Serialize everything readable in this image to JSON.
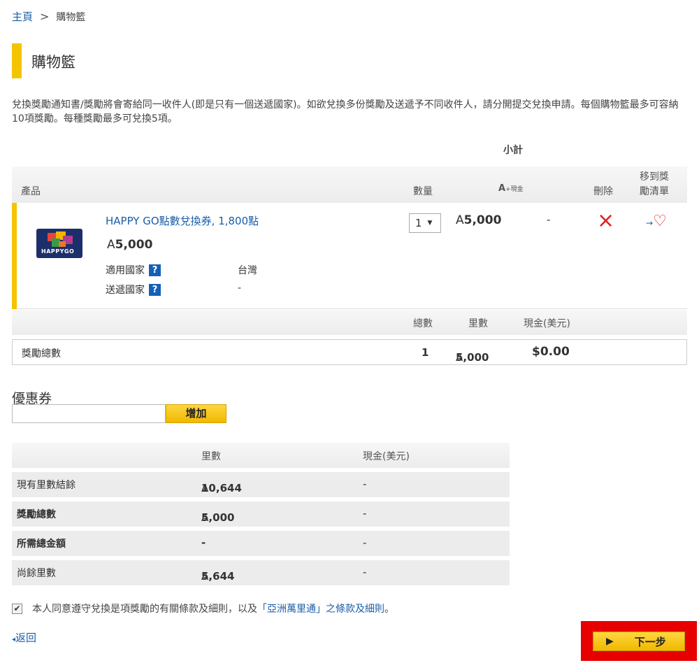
{
  "breadcrumb": {
    "home": "主頁",
    "separator": ">",
    "current": "購物籃"
  },
  "page_title": "購物籃",
  "intro_text": "兌換獎勵通知書/獎勵將會寄給同一收件人(即是只有一個送遞國家)。如欲兌換多份獎勵及送遞予不同收件人，請分開提交兌換申請。每個購物籃最多可容納10項獎勵。每種獎勵最多可兌換5項。",
  "cart": {
    "subtotal_label": "小計",
    "headers": {
      "product": "產品",
      "quantity": "數量",
      "miles_cash": "+現金",
      "delete": "刪除",
      "wishlist_line1": "移到獎",
      "wishlist_line2": "勵清單"
    },
    "item": {
      "name": "HAPPY GO點數兌換券, 1,800點",
      "price": "5,000",
      "country_label": "適用國家",
      "country_value": "台灣",
      "delivery_label": "送遞國家",
      "delivery_value": "-",
      "quantity": "1",
      "subtotal_miles": "5,000",
      "subtotal_cash": "-",
      "logo_text": "HAPPYGO"
    },
    "totals_headers": {
      "count": "總數",
      "miles": "里數",
      "cash": "現金(美元)"
    },
    "totals_row": {
      "label": "獎勵總數",
      "count": "1",
      "miles": "5,000",
      "cash": "$0.00"
    }
  },
  "coupon": {
    "title": "優惠券",
    "input_value": "",
    "add_button": "增加"
  },
  "summary": {
    "headers": {
      "miles": "里數",
      "cash": "現金(美元)"
    },
    "rows": [
      {
        "label": "現有里數結餘",
        "miles": "10,644",
        "cash": "-",
        "bold": false
      },
      {
        "label": "獎勵總數",
        "miles": "5,000",
        "cash": "-",
        "bold": true
      },
      {
        "label": "所需總金額",
        "miles": "-",
        "cash": "-",
        "bold": true
      },
      {
        "label": "尚餘里數",
        "miles": "5,644",
        "cash": "-",
        "bold": false
      }
    ]
  },
  "agreement": {
    "checked": true,
    "text_before": "本人同意遵守兌換是項獎勵的有關條款及細則，以及",
    "link_text": "「亞洲萬里通」之條款及細則",
    "text_after": "。"
  },
  "back_link": "返回",
  "next_button": "下一步",
  "icons": {
    "miles_symbol": "A",
    "delete": "×",
    "wishlist": "♡"
  },
  "colors": {
    "accent_yellow": "#f5c400",
    "link_blue": "#1a5ea8",
    "delete_red": "#e02020",
    "highlight_red": "#e60000"
  }
}
